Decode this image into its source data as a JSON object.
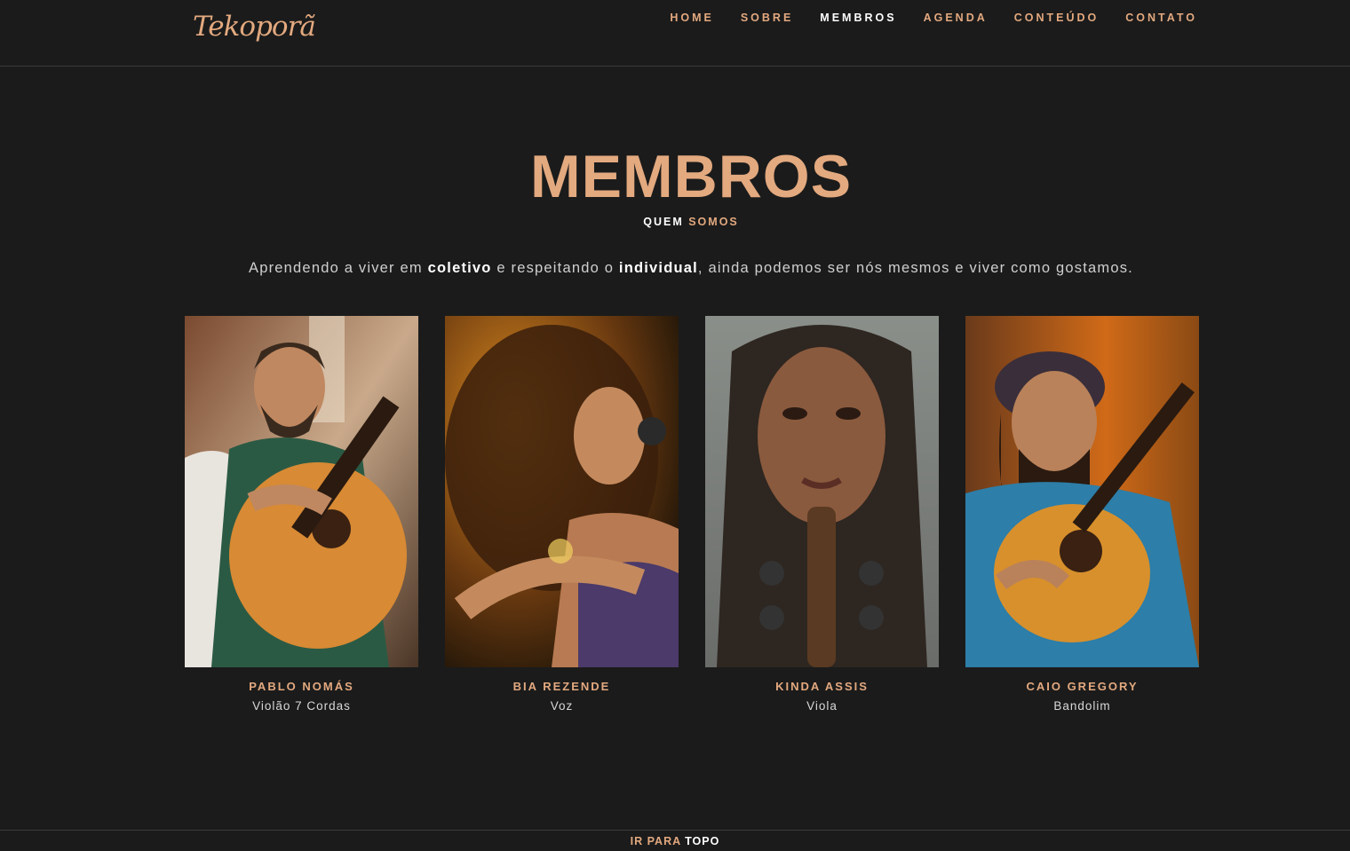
{
  "header": {
    "logo_text": "Tekoporã",
    "nav": [
      {
        "label": "HOME",
        "active": false
      },
      {
        "label": "SOBRE",
        "active": false
      },
      {
        "label": "MEMBROS",
        "active": true
      },
      {
        "label": "AGENDA",
        "active": false
      },
      {
        "label": "CONTEÚDO",
        "active": false
      },
      {
        "label": "CONTATO",
        "active": false
      }
    ]
  },
  "section": {
    "title": "MEMBROS",
    "subtitle_part1": "QUEM",
    "subtitle_part2": "SOMOS",
    "intro": {
      "t1": "Aprendendo a viver em ",
      "b1": "coletivo",
      "t2": " e respeitando o ",
      "b2": "individual",
      "t3": ", ainda podemos ser nós mesmos e viver como gostamos."
    }
  },
  "members": [
    {
      "name": "PABLO NOMÁS",
      "role": "Violão 7 Cordas",
      "photo": "guitarist-photo"
    },
    {
      "name": "BIA REZENDE",
      "role": "Voz",
      "photo": "singer-photo"
    },
    {
      "name": "KINDA ASSIS",
      "role": "Viola",
      "photo": "viola-player-photo"
    },
    {
      "name": "CAIO GREGORY",
      "role": "Bandolim",
      "photo": "mandolin-player-photo"
    }
  ],
  "footer": {
    "part1": "IR PARA",
    "part2": "TOPO"
  },
  "colors": {
    "background": "#1b1b1b",
    "accent": "#e3a97f",
    "text": "#ffffff"
  }
}
